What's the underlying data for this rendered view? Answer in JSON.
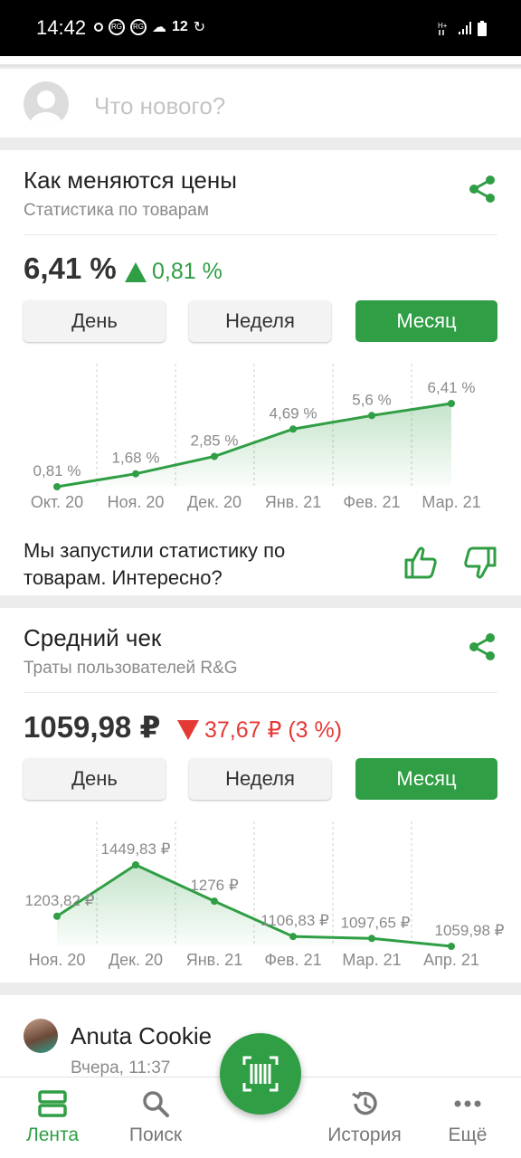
{
  "status_bar": {
    "time": "14:42",
    "temp": "12"
  },
  "composer": {
    "placeholder": "Что нового?"
  },
  "price_card": {
    "title": "Как меняются цены",
    "subtitle": "Статистика по товарам",
    "value": "6,41 %",
    "delta": "0,81 %",
    "delta_direction": "up",
    "periods": [
      "День",
      "Неделя",
      "Месяц"
    ],
    "active_period": "Месяц",
    "feedback_text": "Мы запустили статистику по товарам. Интересно?"
  },
  "check_card": {
    "title": "Средний чек",
    "subtitle": "Траты пользователей R&G",
    "value": "1059,98 ₽",
    "delta": "37,67 ₽ (3 %)",
    "delta_direction": "down",
    "periods": [
      "День",
      "Неделя",
      "Месяц"
    ],
    "active_period": "Месяц"
  },
  "chart_data": [
    {
      "type": "area",
      "categories": [
        "Окт. 20",
        "Ноя. 20",
        "Дек. 20",
        "Янв. 21",
        "Фев. 21",
        "Мар. 21"
      ],
      "values": [
        0.81,
        1.68,
        2.85,
        4.69,
        5.6,
        6.41
      ],
      "labels": [
        "0,81 %",
        "1,68 %",
        "2,85 %",
        "4,69 %",
        "5,6 %",
        "6,41 %"
      ],
      "grid": true,
      "color": "#2f9e44"
    },
    {
      "type": "area",
      "categories": [
        "Ноя. 20",
        "Дек. 20",
        "Янв. 21",
        "Фев. 21",
        "Мар. 21",
        "Апр. 21"
      ],
      "values": [
        1203.82,
        1449.83,
        1276,
        1106.83,
        1097.65,
        1059.98
      ],
      "labels": [
        "1203,82 ₽",
        "1449,83 ₽",
        "1276 ₽",
        "1106,83 ₽",
        "1097,65 ₽",
        "1059,98 ₽"
      ],
      "grid": true,
      "color": "#2f9e44"
    }
  ],
  "post": {
    "author": "Anuta Cookie",
    "time": "Вчера, 11:37"
  },
  "bottom_nav": {
    "feed": "Лента",
    "search": "Поиск",
    "history": "История",
    "more": "Ещё"
  },
  "colors": {
    "accent": "#2f9e44",
    "negative": "#e53935",
    "muted": "#8a8a8a"
  }
}
